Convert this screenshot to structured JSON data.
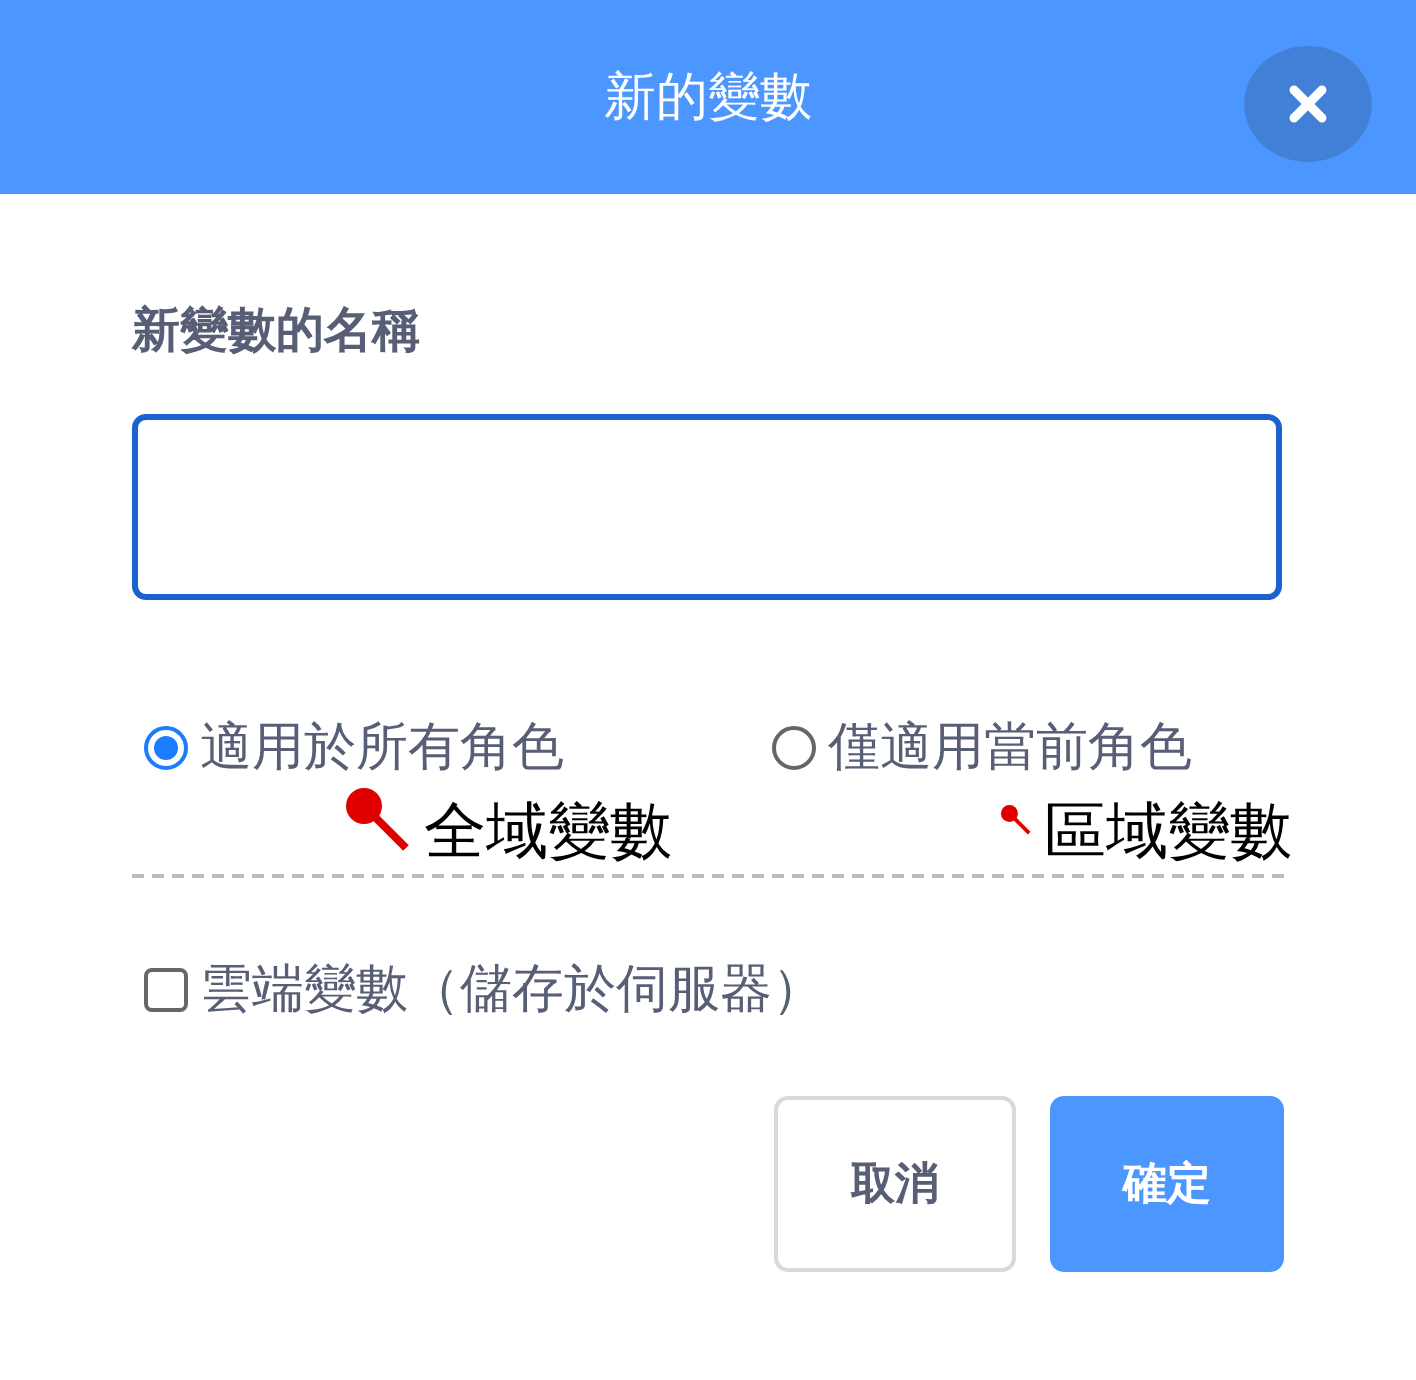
{
  "dialog": {
    "title": "新的變數"
  },
  "name_field": {
    "label": "新變數的名稱"
  },
  "scope_options": [
    {
      "label": "適用於所有角色",
      "selected": true,
      "annotation": "全域變數"
    },
    {
      "label": "僅適用當前角色",
      "selected": false,
      "annotation": "區域變數"
    }
  ],
  "cloud_option": {
    "label": "雲端變數（儲存於伺服器）",
    "checked": false
  },
  "buttons": [
    {
      "label": "取消",
      "kind": "secondary"
    },
    {
      "label": "確定",
      "kind": "primary"
    }
  ]
}
